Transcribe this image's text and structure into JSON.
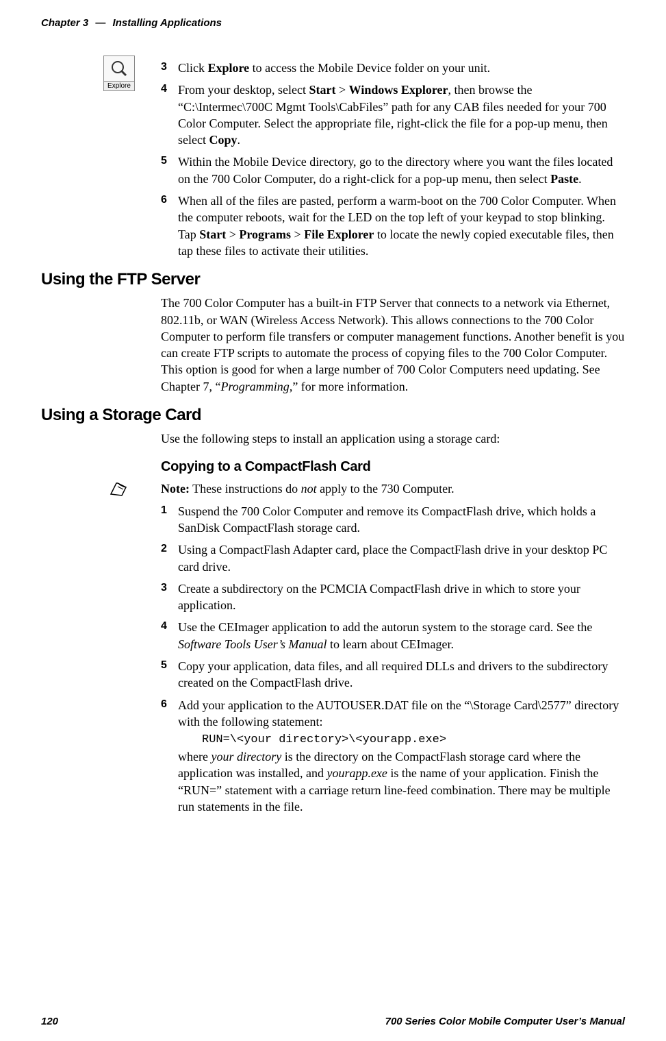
{
  "header": {
    "chapter": "Chapter 3",
    "dash": "—",
    "title": "Installing Applications"
  },
  "icon": {
    "label": "Explore"
  },
  "steps_a": {
    "s3": {
      "num": "3",
      "pre": "Click ",
      "b1": "Explore",
      "post": " to access the Mobile Device folder on your unit."
    },
    "s4": {
      "num": "4",
      "pre": "From your desktop, select ",
      "b1": "Start",
      "sep1": " > ",
      "b2": "Windows Explorer",
      "mid": ", then browse the “C:\\Intermec\\700C Mgmt Tools\\CabFiles” path for any CAB files needed for your 700 Color Computer. Select the appropriate file, right-click the file for a pop-up menu, then select ",
      "b3": "Copy",
      "end": "."
    },
    "s5": {
      "num": "5",
      "pre": "Within the Mobile Device directory, go to the directory where you want the files located on the 700 Color Computer, do a right-click for a pop-up menu, then select ",
      "b1": "Paste",
      "end": "."
    },
    "s6": {
      "num": "6",
      "pre": "When all of the files are pasted, perform a warm-boot on the 700 Color Computer. When the computer reboots, wait for the LED on the top left of your keypad to stop blinking. Tap ",
      "b1": "Start",
      "sep1": " > ",
      "b2": "Programs",
      "sep2": " > ",
      "b3": "File Explorer",
      "post": " to locate the newly copied executable files, then tap these files to activate their utilities."
    }
  },
  "section1": {
    "title": "Using the FTP Server",
    "para_pre": "The 700 Color Computer has a built-in FTP Server that connects to a network via Ethernet, 802.11b, or WAN (Wireless Access Network). This allows connections to the 700 Color Computer to perform file transfers or computer management functions. Another benefit is you can create FTP scripts to automate the process of copying files to the 700 Color Computer. This option is good for when a large number of 700 Color Computers need updating. See Chapter 7, “",
    "para_it": "Programming",
    "para_post": ",” for more information."
  },
  "section2": {
    "title": "Using a Storage Card",
    "intro": "Use the following steps to install an application using a storage card:",
    "sub_title": "Copying to a CompactFlash Card",
    "note_pre": "Note:",
    "note_mid": " These instructions do ",
    "note_it": "not",
    "note_post": " apply to the 730 Computer.",
    "s1": {
      "num": "1",
      "text": "Suspend the 700 Color Computer and remove its CompactFlash drive, which holds a SanDisk CompactFlash storage card."
    },
    "s2": {
      "num": "2",
      "text": "Using a CompactFlash Adapter card, place the CompactFlash drive in your desktop PC card drive."
    },
    "s3": {
      "num": "3",
      "text": "Create a subdirectory on the PCMCIA CompactFlash drive in which to store your application."
    },
    "s4": {
      "num": "4",
      "pre": "Use the CEImager application to add the autorun system to the storage card. See the ",
      "it": "Software Tools User’s Manual",
      "post": " to learn about CEImager."
    },
    "s5": {
      "num": "5",
      "text": "Copy your application, data files, and all required DLLs and drivers to the subdirectory created on the CompactFlash drive."
    },
    "s6": {
      "num": "6",
      "pre": "Add your application to the AUTOUSER.DAT file on the “\\Storage Card\\2577” directory with the following statement:",
      "code": "RUN=\\<your directory>\\<yourapp.exe>",
      "post_a": "where ",
      "it_a": "your directory",
      "post_b": " is the directory on the CompactFlash storage card where the application was installed, and ",
      "it_b": "yourapp.exe",
      "post_c": " is the name of your application. Finish the “RUN=” statement with a carriage return line-feed combination. There may be multiple run statements in the file."
    }
  },
  "footer": {
    "page": "120",
    "title": "700 Series Color Mobile Computer User’s Manual"
  }
}
